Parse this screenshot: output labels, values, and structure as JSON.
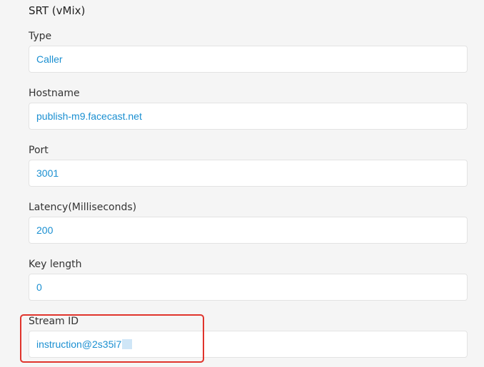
{
  "section": {
    "title": "SRT (vMix)"
  },
  "fields": {
    "type": {
      "label": "Type",
      "value": "Caller"
    },
    "hostname": {
      "label": "Hostname",
      "value": "publish-m9.facecast.net"
    },
    "port": {
      "label": "Port",
      "value": "3001"
    },
    "latency": {
      "label": "Latency(Milliseconds)",
      "value": "200"
    },
    "key_length": {
      "label": "Key length",
      "value": "0"
    },
    "stream_id": {
      "label": "Stream ID",
      "value": "instruction@2s35i7"
    }
  },
  "colors": {
    "value_text": "#1a8fd1",
    "highlight_border": "#e0342c",
    "background": "#f5f5f5"
  }
}
